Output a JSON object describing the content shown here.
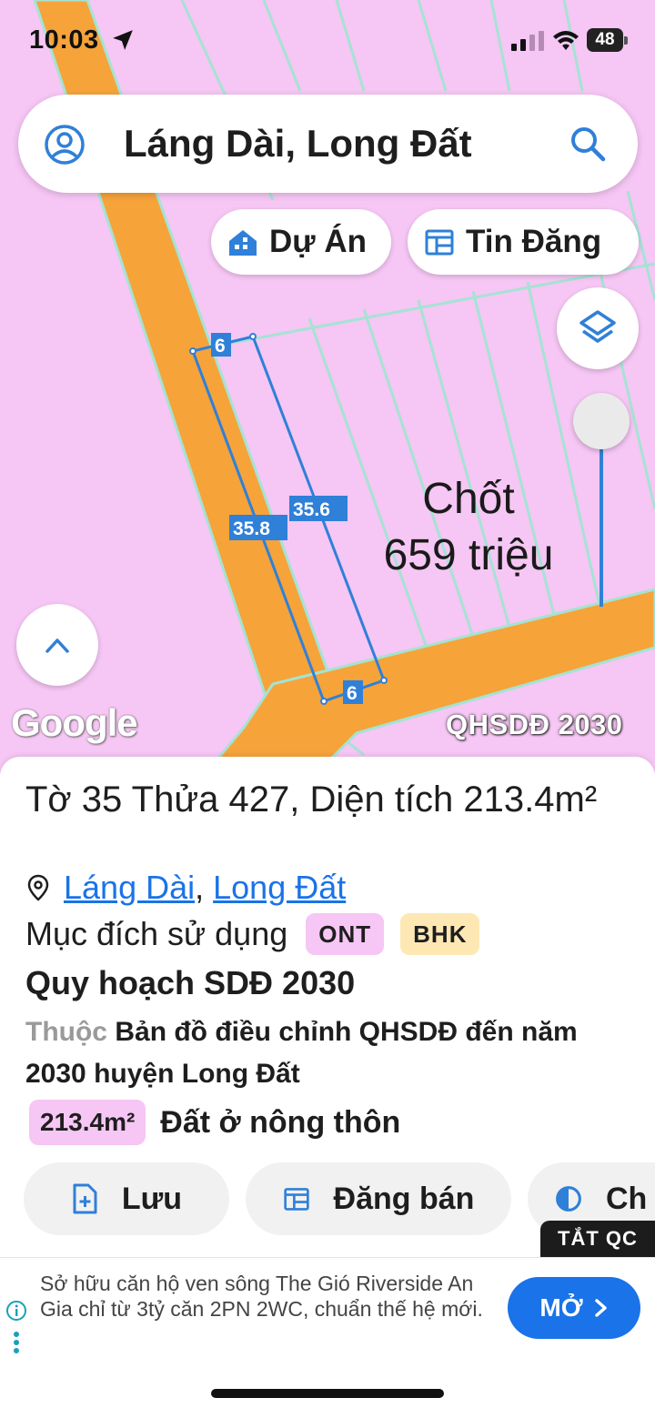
{
  "status_bar": {
    "time": "10:03",
    "battery": "48"
  },
  "search": {
    "text": "Láng Dài, Long Đất"
  },
  "chips": {
    "projects": "Dự Án",
    "listings": "Tin Đăng"
  },
  "map": {
    "parcel_dimensions": {
      "top": "6",
      "left": "35.8",
      "right": "35.6",
      "bottom": "6"
    },
    "annotation_line1": "Chốt",
    "annotation_line2": "659 triệu",
    "google_logo": "Google",
    "layer_name": "QHSDĐ 2030",
    "colors": {
      "land": "#f6c6f4",
      "road": "#f6a33a",
      "parcel_outline": "#2f80d8",
      "grid": "#a5e3d3"
    }
  },
  "panel": {
    "title": "Tờ 35 Thửa 427, Diện tích 213.4m²",
    "address": {
      "commune": "Láng Dài",
      "separator": ",",
      "district": "Long Đất"
    },
    "purpose_label": "Mục đích sử dụng",
    "purpose_tags": [
      "ONT",
      "BHK"
    ],
    "plan_title": "Quy hoạch SDĐ 2030",
    "plan_prefix": "Thuộc",
    "plan_desc": "Bản đồ điều chỉnh QHSDĐ đến năm 2030 huyện Long Đất",
    "area_value": "213.4m²",
    "area_label": "Đất ở nông thôn",
    "actions": {
      "save": "Lưu",
      "post": "Đăng bán",
      "more": "Ch"
    }
  },
  "ad": {
    "close_label": "TẮT QC",
    "text": "Sở hữu căn hộ ven sông The Gió Riverside An Gia chỉ từ 3tỷ căn 2PN 2WC, chuẩn thế hệ mới.",
    "cta": "MỞ"
  }
}
